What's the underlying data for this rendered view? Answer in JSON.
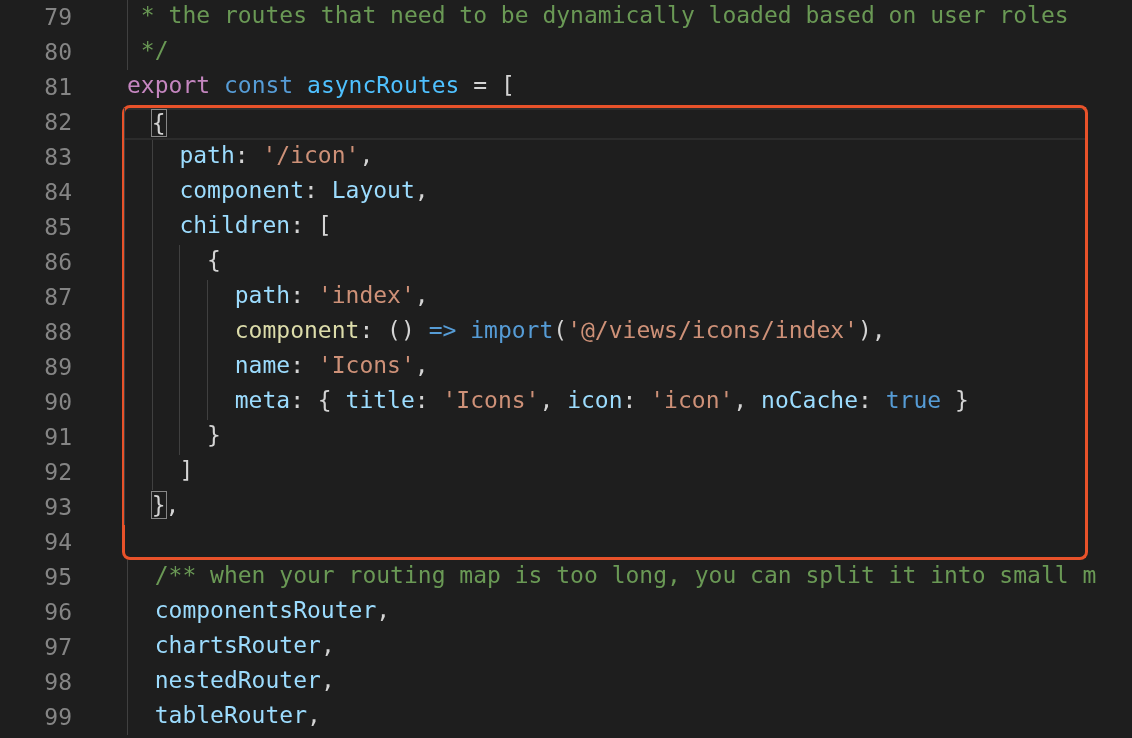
{
  "editor": {
    "lines": [
      {
        "number": "79",
        "framed": false,
        "current": false,
        "tokens": [
          {
            "kind": "comment",
            "text": " * the routes that need to be dynamically loaded based on user roles"
          }
        ]
      },
      {
        "number": "80",
        "framed": false,
        "current": false,
        "tokens": [
          {
            "kind": "comment",
            "text": " */"
          }
        ]
      },
      {
        "number": "81",
        "framed": false,
        "current": false,
        "tokens": [
          {
            "kind": "keyword",
            "text": "export"
          },
          {
            "kind": "storage",
            "text": " const"
          },
          {
            "kind": "constant",
            "text": " asyncRoutes"
          },
          {
            "kind": "plain",
            "text": " = ["
          }
        ]
      },
      {
        "number": "82",
        "framed": true,
        "current": true,
        "tokens": [
          {
            "kind": "bracket",
            "text": "  {"
          }
        ]
      },
      {
        "number": "83",
        "framed": true,
        "current": false,
        "tokens": [
          {
            "kind": "property",
            "text": "    path"
          },
          {
            "kind": "plain",
            "text": ": "
          },
          {
            "kind": "string",
            "text": "'/icon'"
          },
          {
            "kind": "plain",
            "text": ","
          }
        ]
      },
      {
        "number": "84",
        "framed": true,
        "current": false,
        "tokens": [
          {
            "kind": "property",
            "text": "    component"
          },
          {
            "kind": "plain",
            "text": ": "
          },
          {
            "kind": "property",
            "text": "Layout"
          },
          {
            "kind": "plain",
            "text": ","
          }
        ]
      },
      {
        "number": "85",
        "framed": true,
        "current": false,
        "tokens": [
          {
            "kind": "property",
            "text": "    children"
          },
          {
            "kind": "plain",
            "text": ": ["
          }
        ]
      },
      {
        "number": "86",
        "framed": true,
        "current": false,
        "tokens": [
          {
            "kind": "plain",
            "text": "      {"
          }
        ]
      },
      {
        "number": "87",
        "framed": true,
        "current": false,
        "tokens": [
          {
            "kind": "property",
            "text": "        path"
          },
          {
            "kind": "plain",
            "text": ": "
          },
          {
            "kind": "string",
            "text": "'index'"
          },
          {
            "kind": "plain",
            "text": ","
          }
        ]
      },
      {
        "number": "88",
        "framed": true,
        "current": false,
        "tokens": [
          {
            "kind": "function",
            "text": "        component"
          },
          {
            "kind": "plain",
            "text": ": () "
          },
          {
            "kind": "storage",
            "text": "=>"
          },
          {
            "kind": "storage",
            "text": " import"
          },
          {
            "kind": "plain",
            "text": "("
          },
          {
            "kind": "string",
            "text": "'@/views/icons/index'"
          },
          {
            "kind": "plain",
            "text": "),"
          }
        ]
      },
      {
        "number": "89",
        "framed": true,
        "current": false,
        "tokens": [
          {
            "kind": "property",
            "text": "        name"
          },
          {
            "kind": "plain",
            "text": ": "
          },
          {
            "kind": "string",
            "text": "'Icons'"
          },
          {
            "kind": "plain",
            "text": ","
          }
        ]
      },
      {
        "number": "90",
        "framed": true,
        "current": false,
        "tokens": [
          {
            "kind": "property",
            "text": "        meta"
          },
          {
            "kind": "plain",
            "text": ": { "
          },
          {
            "kind": "property",
            "text": "title"
          },
          {
            "kind": "plain",
            "text": ": "
          },
          {
            "kind": "string",
            "text": "'Icons'"
          },
          {
            "kind": "plain",
            "text": ", "
          },
          {
            "kind": "property",
            "text": "icon"
          },
          {
            "kind": "plain",
            "text": ": "
          },
          {
            "kind": "string",
            "text": "'icon'"
          },
          {
            "kind": "plain",
            "text": ", "
          },
          {
            "kind": "property",
            "text": "noCache"
          },
          {
            "kind": "plain",
            "text": ": "
          },
          {
            "kind": "storage",
            "text": "true"
          },
          {
            "kind": "plain",
            "text": " }"
          }
        ]
      },
      {
        "number": "91",
        "framed": true,
        "current": false,
        "tokens": [
          {
            "kind": "plain",
            "text": "      }"
          }
        ]
      },
      {
        "number": "92",
        "framed": true,
        "current": false,
        "tokens": [
          {
            "kind": "plain",
            "text": "    ]"
          }
        ]
      },
      {
        "number": "93",
        "framed": true,
        "current": false,
        "tokens": [
          {
            "kind": "bracket",
            "text": "  }"
          },
          {
            "kind": "plain",
            "text": ","
          }
        ]
      },
      {
        "number": "94",
        "framed": true,
        "current": false
      },
      {
        "number": "95",
        "framed": false,
        "current": false,
        "tokens": [
          {
            "kind": "comment",
            "text": "  /** when your routing map is too long, you can split it into small m"
          }
        ]
      },
      {
        "number": "96",
        "framed": false,
        "current": false,
        "tokens": [
          {
            "kind": "property",
            "text": "  componentsRouter"
          },
          {
            "kind": "plain",
            "text": ","
          }
        ]
      },
      {
        "number": "97",
        "framed": false,
        "current": false,
        "tokens": [
          {
            "kind": "property",
            "text": "  chartsRouter"
          },
          {
            "kind": "plain",
            "text": ","
          }
        ]
      },
      {
        "number": "98",
        "framed": false,
        "current": false,
        "tokens": [
          {
            "kind": "property",
            "text": "  nestedRouter"
          },
          {
            "kind": "plain",
            "text": ","
          }
        ]
      },
      {
        "number": "99",
        "framed": false,
        "current": false,
        "tokens": [
          {
            "kind": "property",
            "text": "  tableRouter"
          },
          {
            "kind": "plain",
            "text": ","
          }
        ]
      }
    ]
  }
}
